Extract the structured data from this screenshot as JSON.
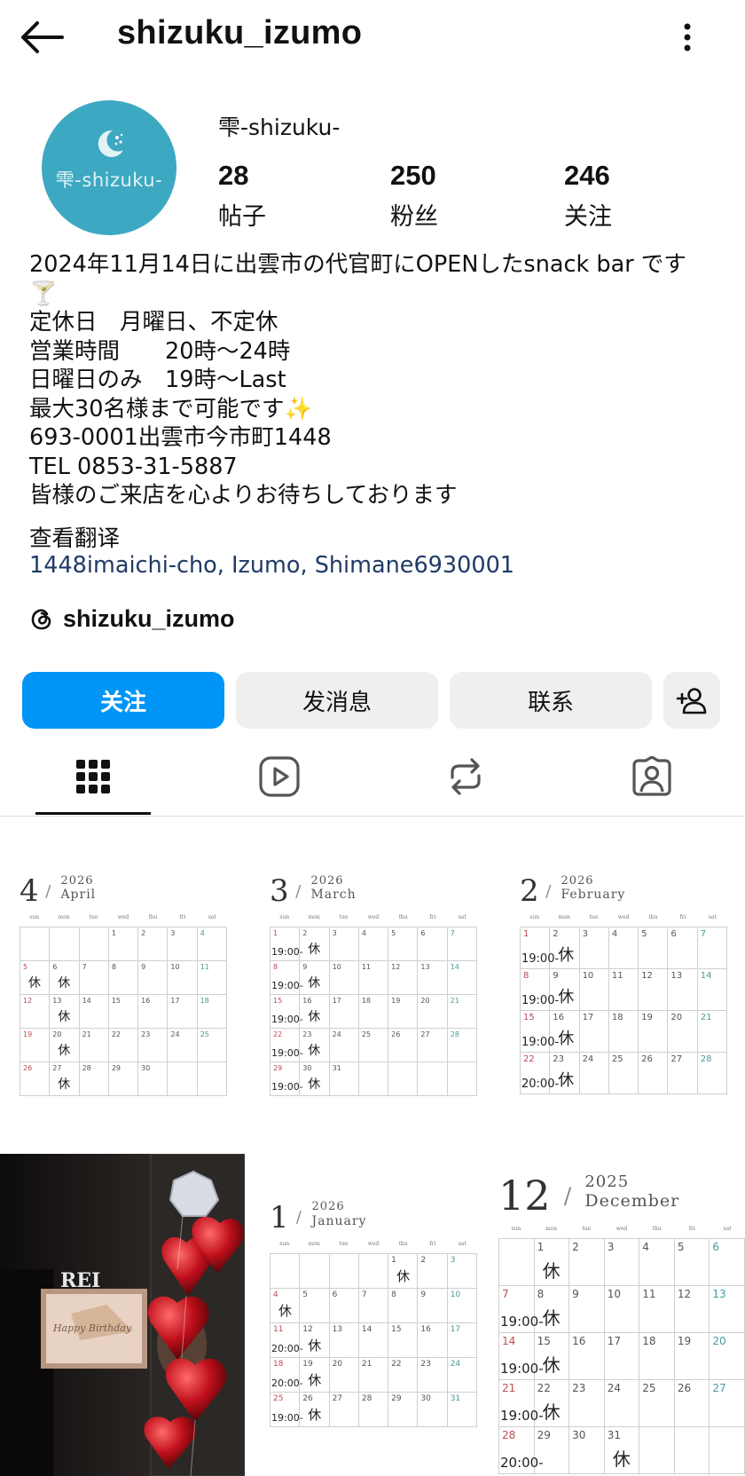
{
  "header": {
    "username": "shizuku_izumo"
  },
  "profile": {
    "avatar_text": "雫-shizuku-",
    "display_name": "雫-shizuku-",
    "stats": [
      {
        "value": "28",
        "label": "帖子"
      },
      {
        "value": "250",
        "label": "粉丝"
      },
      {
        "value": "246",
        "label": "关注"
      }
    ],
    "bio_lines": [
      "2024年11月14日に出雲市の代官町にOPENしたsnack bar です",
      "🍸",
      "定休日　月曜日、不定休",
      "営業時間　　20時〜24時",
      "日曜日のみ　19時〜Last",
      "最大30名様まで可能です✨",
      "693-0001出雲市今市町1448",
      "TEL 0853-31-5887",
      "皆様のご来店を心よりお待ちしております"
    ],
    "translate_label": "查看翻译",
    "location": "1448imaichi-cho, Izumo, Shimane6930001",
    "threads_handle": "shizuku_izumo"
  },
  "actions": {
    "follow": "关注",
    "message": "发消息",
    "contact": "联系"
  },
  "tabs": [
    "posts-grid",
    "reels",
    "reposts",
    "tagged"
  ],
  "colors": {
    "primary": "#0095f6",
    "avatar_bg": "#3da8c2",
    "button_bg": "#efefef",
    "location": "#1f3a66"
  },
  "posts": [
    {
      "month_num": "4",
      "year": "2026",
      "month_name": "April",
      "first_dow": 3,
      "days": 30,
      "events": {
        "5": "休",
        "6": "休",
        "13": "休",
        "20": "休",
        "27": "休"
      }
    },
    {
      "month_num": "3",
      "year": "2026",
      "month_name": "March",
      "first_dow": 0,
      "days": 31,
      "events": {
        "1": "19:00-",
        "2": "休",
        "8": "19:00-",
        "9": "休",
        "15": "19:00-",
        "16": "休",
        "22": "19:00-",
        "23": "休",
        "29": "19:00-",
        "30": "休"
      }
    },
    {
      "month_num": "2",
      "year": "2026",
      "month_name": "February",
      "first_dow": 0,
      "days": 28,
      "events": {
        "1": "19:00-",
        "2": "休",
        "8": "19:00-",
        "9": "休",
        "15": "19:00-",
        "16": "休",
        "22": "20:00-",
        "23": "休"
      }
    },
    {
      "month_num": "1",
      "year": "2026",
      "month_name": "January",
      "first_dow": 4,
      "days": 31,
      "events": {
        "1": "休",
        "4": "休",
        "11": "20:00-",
        "12": "休",
        "18": "20:00-",
        "19": "休",
        "25": "19:00-",
        "26": "休"
      }
    },
    {
      "month_num": "12",
      "year": "2025",
      "month_name": "December",
      "first_dow": 1,
      "days": 31,
      "events": {
        "1": "休",
        "7": "19:00-",
        "8": "休",
        "14": "19:00-",
        "15": "休",
        "21": "19:00-",
        "22": "休",
        "28": "20:00-",
        "31": "休"
      }
    }
  ],
  "calendar_dow_labels": [
    "sun",
    "mon",
    "tue",
    "wed",
    "thu",
    "fri",
    "sat"
  ],
  "photo": {
    "letters": "REI",
    "banner_text": "Happy Birthday"
  }
}
